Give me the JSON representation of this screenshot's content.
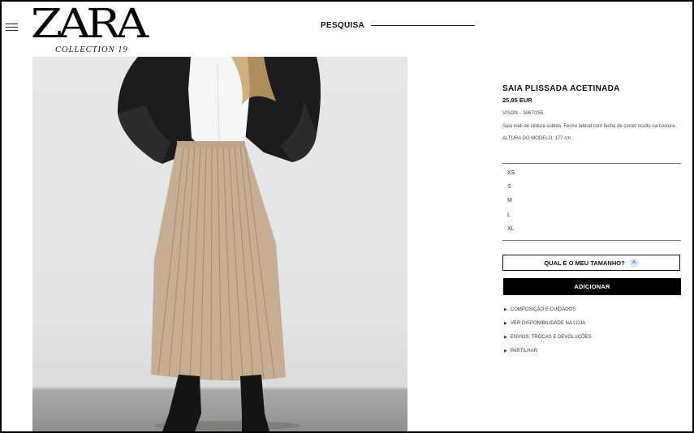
{
  "header": {
    "logo": "ZARA",
    "logo_sub": "COLLECTION 19",
    "search_label": "PESQUISA"
  },
  "product": {
    "title": "SAIA PLISSADA ACETINADA",
    "price": "25,95 EUR",
    "ref": "VISON – 3067/255",
    "description": "Saia midi de cintura subida. Fecho lateral com fecho de correr oculto na costura.",
    "model_height": "ALTURA DO MODELO: 177 cm."
  },
  "sizes": [
    "XS",
    "S",
    "M",
    "L",
    "XL"
  ],
  "buttons": {
    "size_help": "QUAL É O MEU TAMANHO?",
    "size_help_badge": "A",
    "add": "ADICIONAR"
  },
  "links": [
    "COMPOSIÇÃO E CUIDADOS",
    "VER DISPONIBILIDADE NA LOJA",
    "ENVIOS, TROCAS E DEVOLUÇÕES",
    "PARTILHAR"
  ],
  "colors": {
    "skirt": "#c7ad92",
    "jacket": "#1c1c1e",
    "background": "#e4e5e7"
  }
}
